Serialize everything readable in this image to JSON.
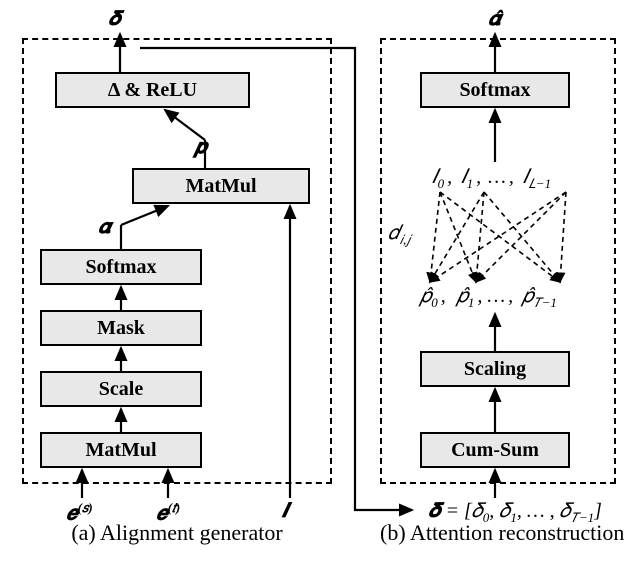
{
  "panel_a": {
    "caption": "(a) Alignment generator",
    "blocks": {
      "matmul_bot": "MatMul",
      "scale": "Scale",
      "mask": "Mask",
      "softmax": "Softmax",
      "matmul_top": "MatMul",
      "deltarelu": "Δ & ReLU"
    },
    "inputs": {
      "e_s": "𝒆",
      "e_s_sup": "(𝑠)",
      "e_t": "𝒆",
      "e_t_sup": "(𝑡)",
      "I": "𝑰"
    },
    "mid": {
      "alpha": "𝜶",
      "p": "𝒑"
    },
    "output": "𝜹"
  },
  "panel_b": {
    "caption": "(b) Attention reconstruction",
    "blocks": {
      "cumsum": "Cum-Sum",
      "scaling": "Scaling",
      "softmax": "Softmax"
    },
    "output": "𝜶̂",
    "input_delta": "𝜹 = [𝛿₀, 𝛿₁, …, 𝛿_{T−1}]",
    "bipartite": {
      "top": [
        "𝐼₀",
        "𝐼₁",
        "…",
        "𝐼",
        "𝐿−1"
      ],
      "bot": [
        "𝑝̂₀",
        "𝑝̂₁",
        "…",
        "𝑝̂",
        "𝑇−1"
      ],
      "edge_label": "𝑑",
      "edge_sub": "𝑖,𝑗"
    }
  }
}
